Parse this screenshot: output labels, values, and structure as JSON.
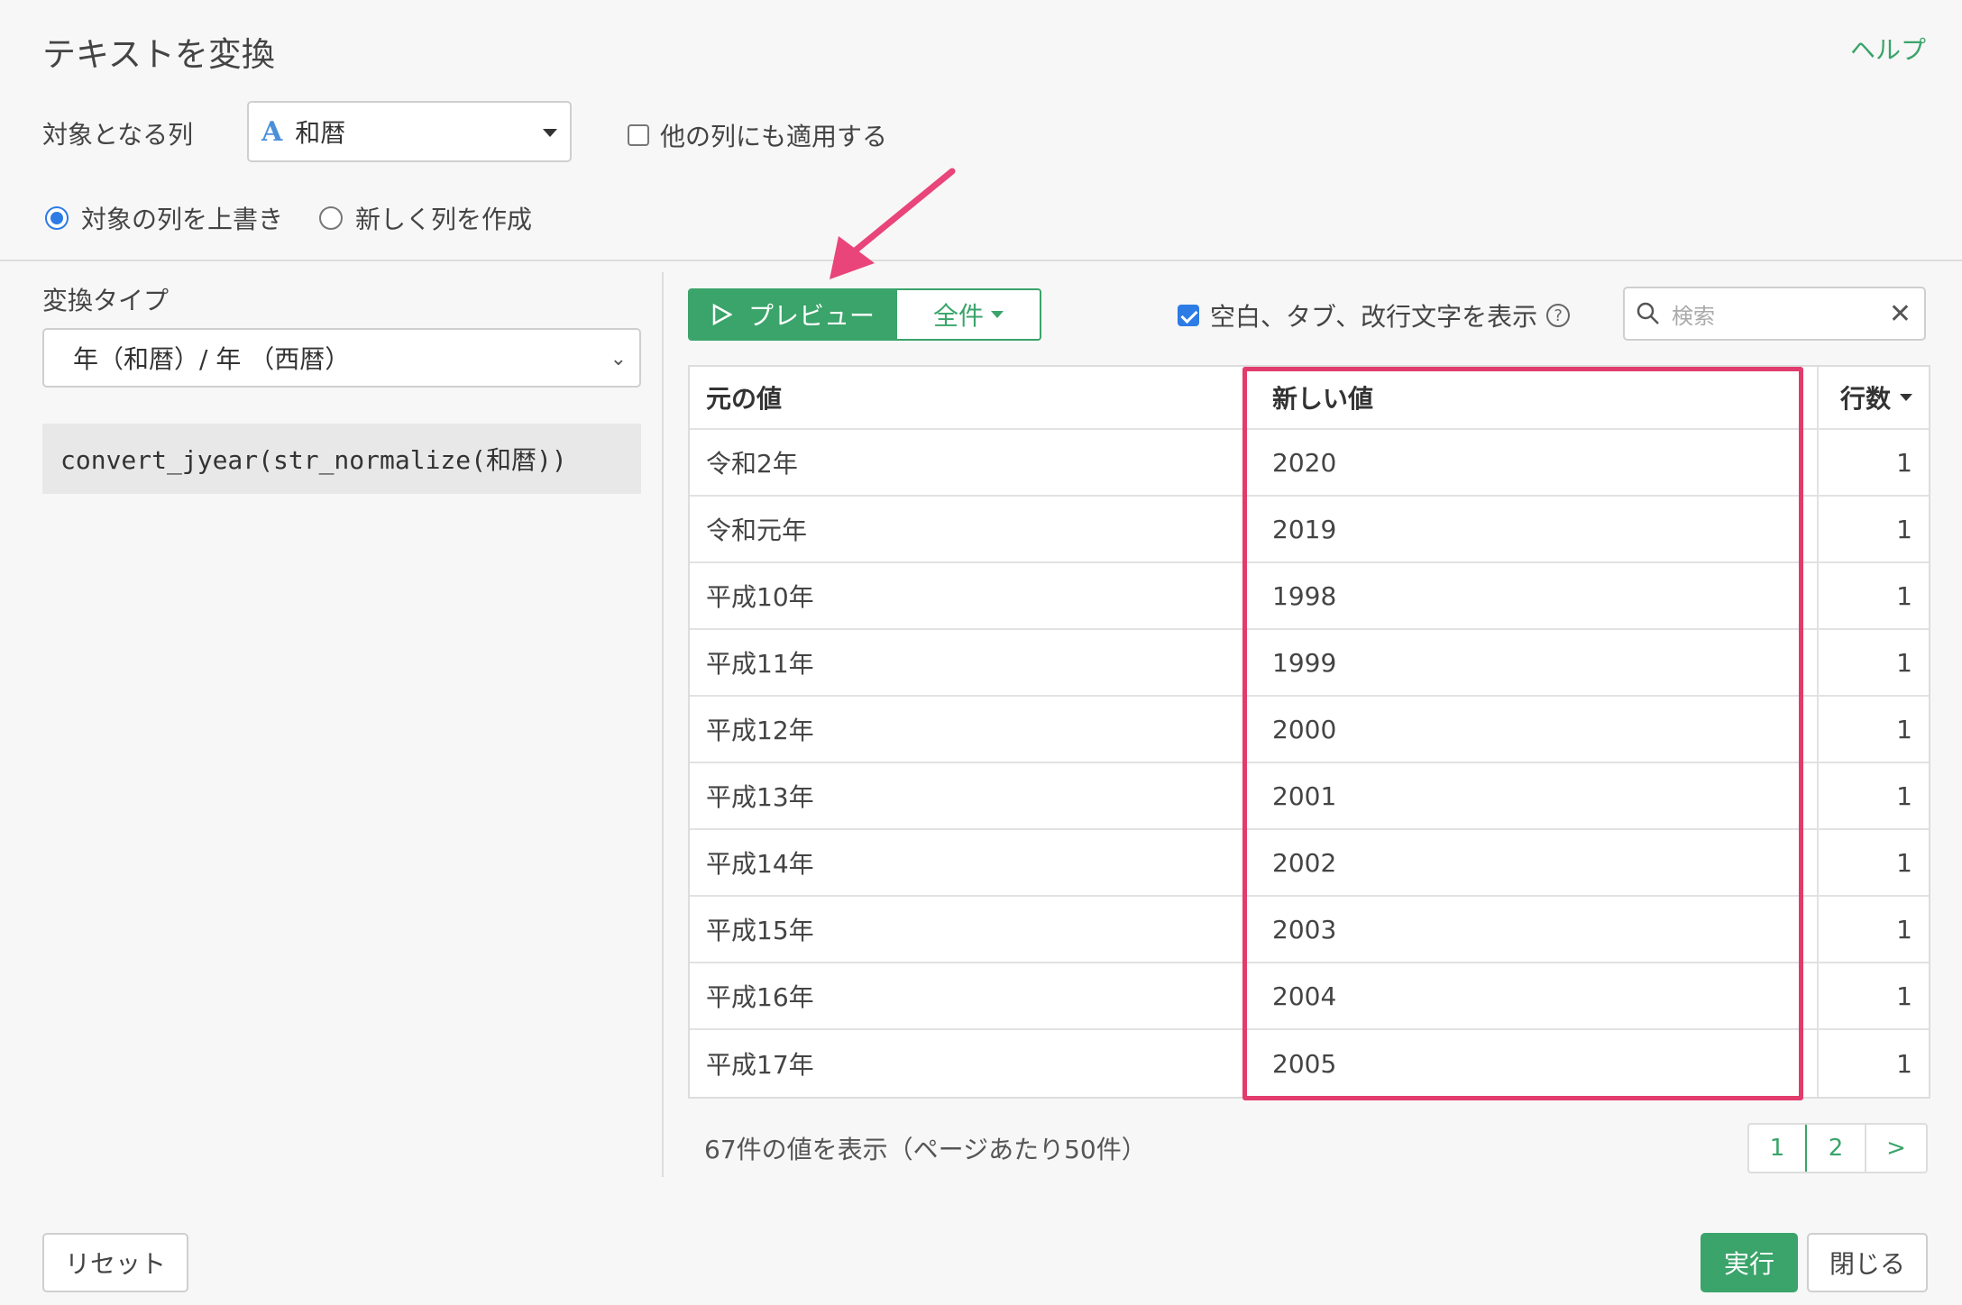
{
  "dialog": {
    "title": "テキストを変換",
    "help": "ヘルプ"
  },
  "target": {
    "label": "対象となる列",
    "column_type_icon": "A",
    "column": "和暦",
    "apply_other": "他の列にも適用する"
  },
  "mode": {
    "overwrite": "対象の列を上書き",
    "new_column": "新しく列を作成",
    "selected": "overwrite"
  },
  "conversion": {
    "label": "変換タイプ",
    "type": "年（和暦）/ 年 （西暦）",
    "expression": "convert_jyear(str_normalize(和暦))"
  },
  "toolbar": {
    "preview": "プレビュー",
    "all": "全件",
    "show_whitespace": "空白、タブ、改行文字を表示",
    "search_placeholder": "検索"
  },
  "table": {
    "headers": [
      "元の値",
      "新しい値",
      "行数"
    ],
    "rows": [
      [
        "令和2年",
        "2020",
        "1"
      ],
      [
        "令和元年",
        "2019",
        "1"
      ],
      [
        "平成10年",
        "1998",
        "1"
      ],
      [
        "平成11年",
        "1999",
        "1"
      ],
      [
        "平成12年",
        "2000",
        "1"
      ],
      [
        "平成13年",
        "2001",
        "1"
      ],
      [
        "平成14年",
        "2002",
        "1"
      ],
      [
        "平成15年",
        "2003",
        "1"
      ],
      [
        "平成16年",
        "2004",
        "1"
      ],
      [
        "平成17年",
        "2005",
        "1"
      ]
    ]
  },
  "footer": {
    "info": "67件の値を表示（ページあたり50件）",
    "pages": [
      "1",
      "2",
      ">"
    ]
  },
  "actions": {
    "reset": "リセット",
    "run": "実行",
    "close": "閉じる"
  },
  "colors": {
    "accent": "#3aa46a",
    "highlight": "#e23b6c",
    "checkbox": "#2d7be5"
  }
}
